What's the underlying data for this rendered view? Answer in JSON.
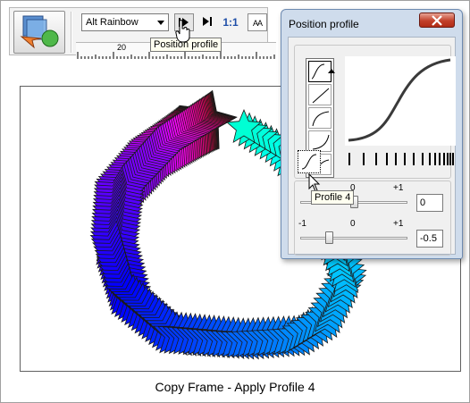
{
  "toolbar": {
    "gradient_combo_value": "Alt Rainbow",
    "ratio_label": "1:1",
    "aa_label": "AA",
    "ruler_label": "20",
    "play_tooltip": "Position profile"
  },
  "dialog": {
    "title": "Position profile",
    "close_label": "x",
    "profile_tooltip": "Profile 4",
    "top_scale": {
      "min": "0",
      "max": "+1"
    },
    "top_value": "0",
    "bottom_scale": {
      "min": "-1",
      "mid": "0",
      "max": "+1"
    },
    "bottom_value": "-0.5",
    "bottom_slider_level": 0.25,
    "top_slider_level": 0.5,
    "profiles": [
      "profile-1",
      "profile-2",
      "profile-3",
      "profile-4",
      "profile-5",
      "profile-6"
    ]
  },
  "caption": "Copy Frame - Apply Profile 4",
  "colors": {
    "accent_blue": "#1f4fa8",
    "close_red": "#c2402a",
    "dialog_frame": "#cfdcec"
  }
}
